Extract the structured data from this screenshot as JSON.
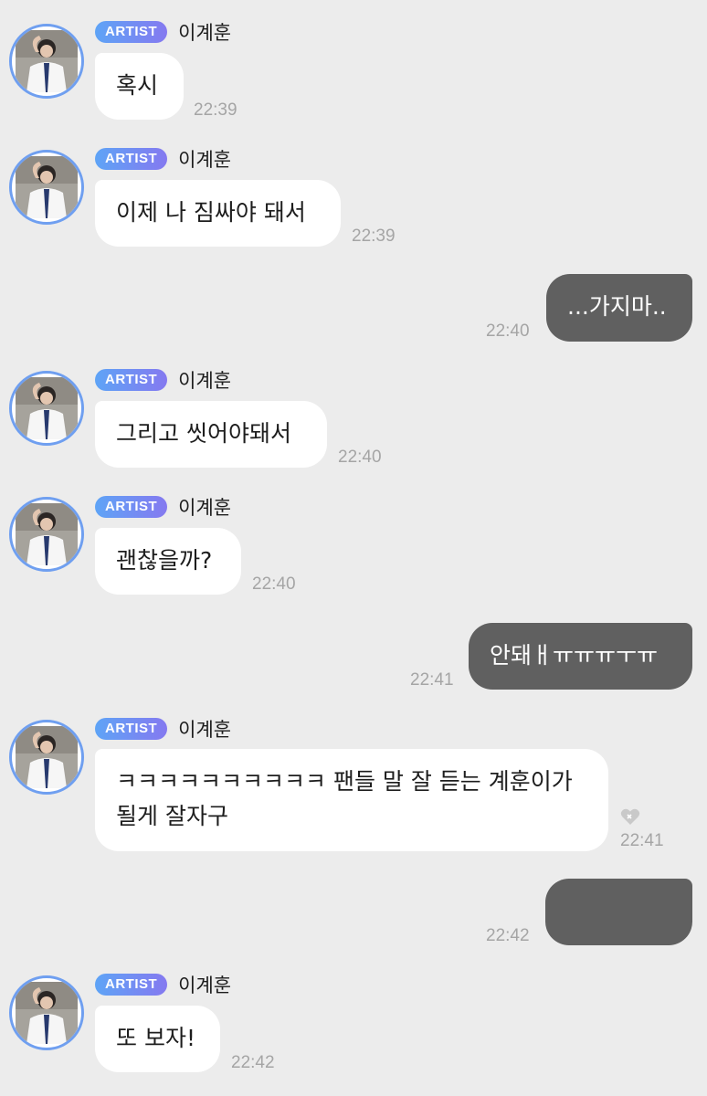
{
  "badge_label": "ARTIST",
  "sender_name": "이계훈",
  "colors": {
    "background": "#ececec",
    "incoming_bubble": "#ffffff",
    "outgoing_bubble": "#606060",
    "badge_start": "#5ea4f6",
    "badge_end": "#8579f0",
    "avatar_ring": "#6f9ff0",
    "timestamp": "#a5a5a5"
  },
  "messages": [
    {
      "direction": "in",
      "text": "혹시",
      "time": "22:39"
    },
    {
      "direction": "in",
      "text": "이제 나 짐싸야 돼서",
      "time": "22:39"
    },
    {
      "direction": "out",
      "text": "...가지마..",
      "time": "22:40"
    },
    {
      "direction": "in",
      "text": "그리고 씻어야돼서",
      "time": "22:40"
    },
    {
      "direction": "in",
      "text": "괜찮을까?",
      "time": "22:40"
    },
    {
      "direction": "out",
      "text": "안돼ㅐㅠㅠㅠㅜㅠ",
      "time": "22:41"
    },
    {
      "direction": "in",
      "line1": "ㅋㅋㅋㅋㅋㅋㅋㅋㅋㅋ 팬들 말 잘 듣는 계훈이가",
      "line2": "될게 잘자구",
      "time": "22:41",
      "reaction_icon": "heart-icon"
    },
    {
      "direction": "out",
      "text": "",
      "time": "22:42",
      "redacted": true
    },
    {
      "direction": "in",
      "text": "또 보자!",
      "time": "22:42"
    }
  ]
}
